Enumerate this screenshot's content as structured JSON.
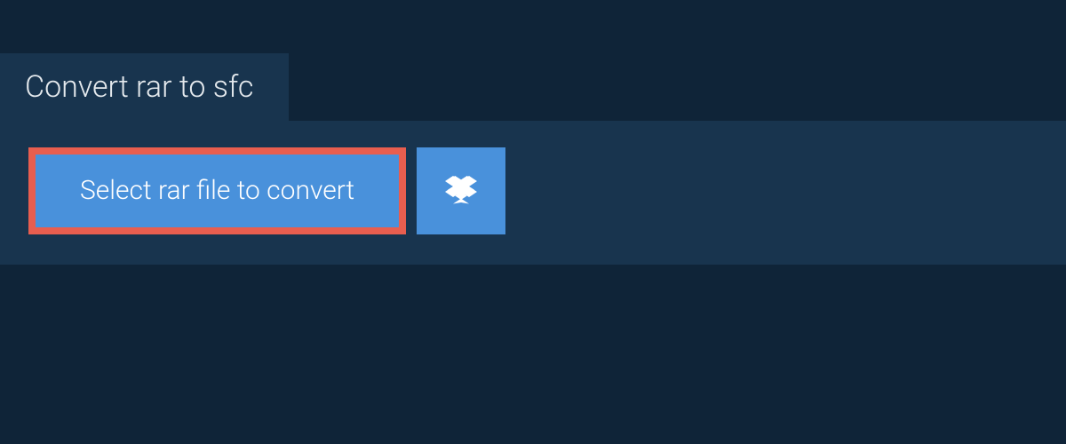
{
  "header": {
    "title": "Convert rar to sfc"
  },
  "actions": {
    "select_file_label": "Select rar file to convert",
    "dropbox_icon": "dropbox-icon"
  },
  "colors": {
    "background": "#0f2438",
    "panel": "#18344e",
    "button": "#4991db",
    "highlight_border": "#e85e4f",
    "text_light": "#e4e9ed",
    "text_white": "#ffffff"
  }
}
